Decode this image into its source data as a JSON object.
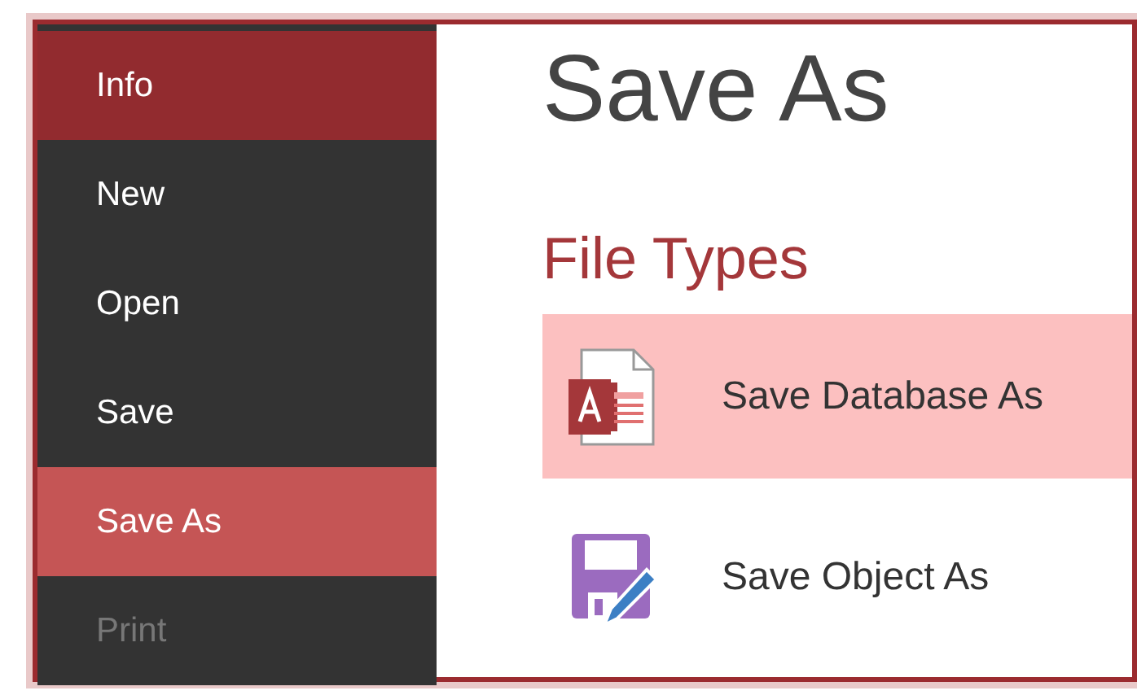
{
  "sidebar": {
    "items": [
      {
        "label": "Info",
        "selected": false,
        "hovered": true,
        "disabled": false
      },
      {
        "label": "New",
        "selected": false,
        "hovered": false,
        "disabled": false
      },
      {
        "label": "Open",
        "selected": false,
        "hovered": false,
        "disabled": false
      },
      {
        "label": "Save",
        "selected": false,
        "hovered": false,
        "disabled": false
      },
      {
        "label": "Save As",
        "selected": true,
        "hovered": false,
        "disabled": false
      },
      {
        "label": "Print",
        "selected": false,
        "hovered": false,
        "disabled": true
      }
    ]
  },
  "content": {
    "title": "Save As",
    "section": "File Types",
    "file_types": [
      {
        "kind": "database",
        "label": "Save Database As",
        "selected": true
      },
      {
        "kind": "object",
        "label": "Save Object As",
        "selected": false
      }
    ]
  }
}
